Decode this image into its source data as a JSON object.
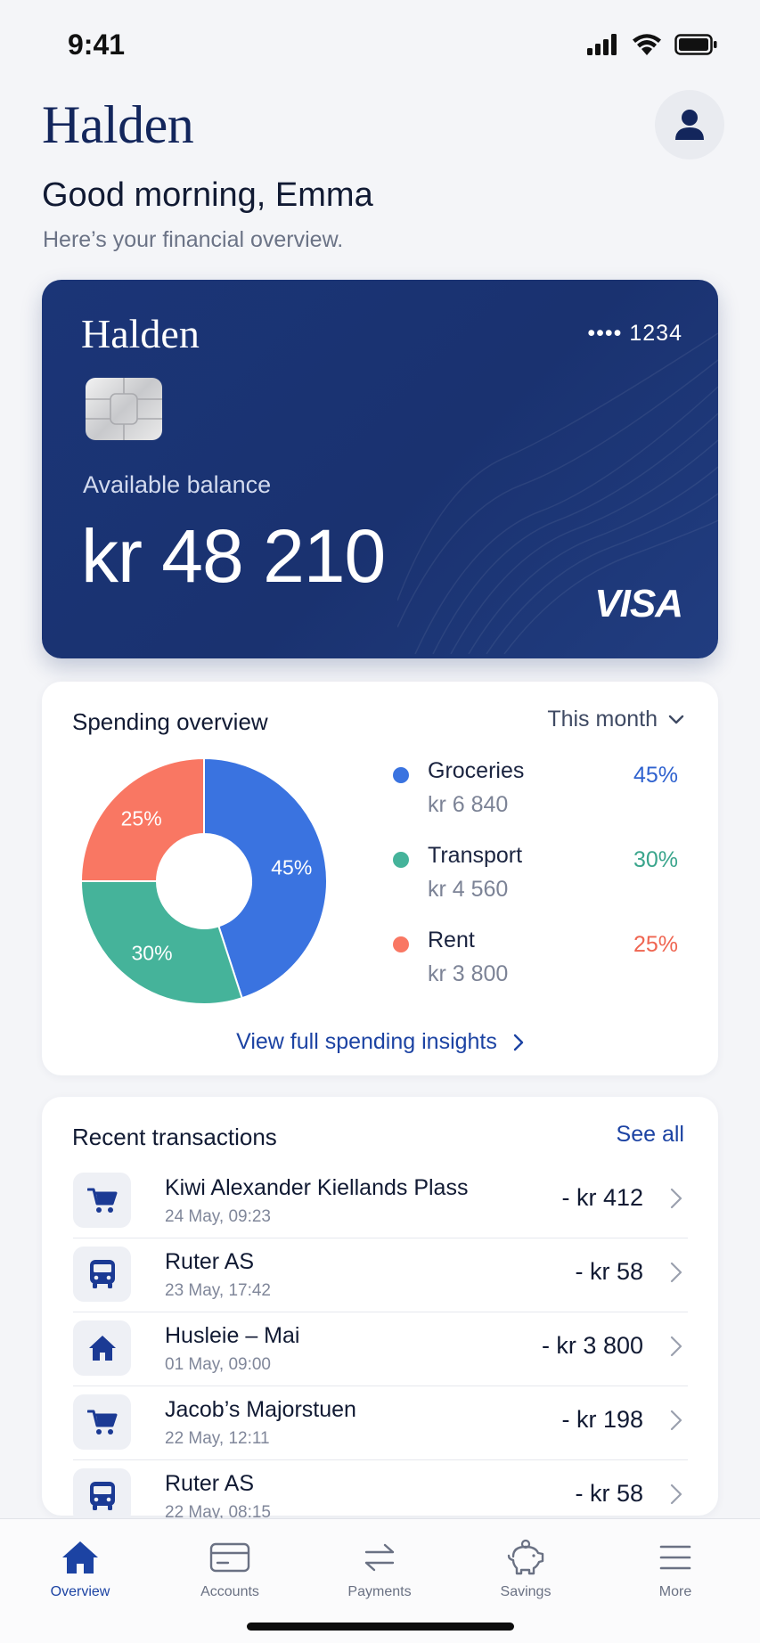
{
  "status": {
    "time": "9:41"
  },
  "header": {
    "brand": "Halden"
  },
  "greeting": {
    "title": "Good morning, Emma",
    "subtitle": "Here’s your financial overview."
  },
  "card": {
    "brand": "Halden",
    "number": "•••• 1234",
    "label": "Available balance",
    "balance": "kr 48 210",
    "network": "VISA",
    "color": "#1b3577"
  },
  "spending": {
    "title": "Spending overview",
    "period": "This month",
    "link": "View full spending insights",
    "categories": [
      {
        "name": "Groceries",
        "amount": "kr 6 840",
        "percent": "45%",
        "value": 45,
        "color": "#3a73e0"
      },
      {
        "name": "Transport",
        "amount": "kr 4 560",
        "percent": "30%",
        "value": 30,
        "color": "#45b39a"
      },
      {
        "name": "Rent",
        "amount": "kr 3 800",
        "percent": "25%",
        "value": 25,
        "color": "#f97763"
      }
    ]
  },
  "transactions": {
    "title": "Recent transactions",
    "see_all": "See all",
    "items": [
      {
        "name": "Kiwi Alexander Kiellands Plass",
        "date": "24 May, 09:23",
        "amount": "- kr 412",
        "icon": "cart-icon"
      },
      {
        "name": "Ruter AS",
        "date": "23 May, 17:42",
        "amount": "- kr 58",
        "icon": "bus-icon"
      },
      {
        "name": "Husleie – Mai",
        "date": "01 May, 09:00",
        "amount": "- kr 3 800",
        "icon": "home-icon"
      },
      {
        "name": "Jacob’s Majorstuen",
        "date": "22 May, 12:11",
        "amount": "- kr 198",
        "icon": "cart-icon"
      },
      {
        "name": "Ruter AS",
        "date": "22 May, 08:15",
        "amount": "- kr 58",
        "icon": "bus-icon"
      }
    ]
  },
  "tabs": [
    {
      "label": "Overview",
      "icon": "home-icon",
      "active": true
    },
    {
      "label": "Accounts",
      "icon": "card-icon",
      "active": false
    },
    {
      "label": "Payments",
      "icon": "transfer-icon",
      "active": false
    },
    {
      "label": "Savings",
      "icon": "piggy-bank-icon",
      "active": false
    },
    {
      "label": "More",
      "icon": "menu-icon",
      "active": false
    }
  ],
  "colors": {
    "accent": "#1c43a3",
    "navy": "#13265c"
  }
}
